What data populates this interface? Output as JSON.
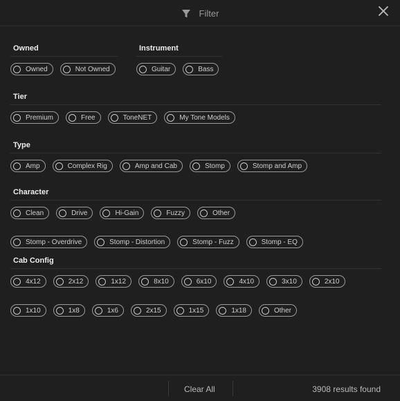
{
  "header": {
    "title": "Filter"
  },
  "sections": {
    "owned": {
      "title": "Owned",
      "options": [
        "Owned",
        "Not Owned"
      ]
    },
    "instrument": {
      "title": "Instrument",
      "options": [
        "Guitar",
        "Bass"
      ]
    },
    "tier": {
      "title": "Tier",
      "options": [
        "Premium",
        "Free",
        "ToneNET",
        "My Tone Models"
      ]
    },
    "type": {
      "title": "Type",
      "options": [
        "Amp",
        "Complex Rig",
        "Amp and Cab",
        "Stomp",
        "Stomp and Amp"
      ]
    },
    "character": {
      "title": "Character",
      "options": [
        "Clean",
        "Drive",
        "Hi-Gain",
        "Fuzzy",
        "Other",
        "Stomp - Overdrive",
        "Stomp - Distortion",
        "Stomp - Fuzz",
        "Stomp - EQ"
      ]
    },
    "cab_config": {
      "title": "Cab Config",
      "options": [
        "4x12",
        "2x12",
        "1x12",
        "8x10",
        "6x10",
        "4x10",
        "3x10",
        "2x10",
        "1x10",
        "1x8",
        "1x6",
        "2x15",
        "1x15",
        "1x18",
        "Other"
      ]
    }
  },
  "footer": {
    "clear_all": "Clear All",
    "results": "3908 results found"
  }
}
